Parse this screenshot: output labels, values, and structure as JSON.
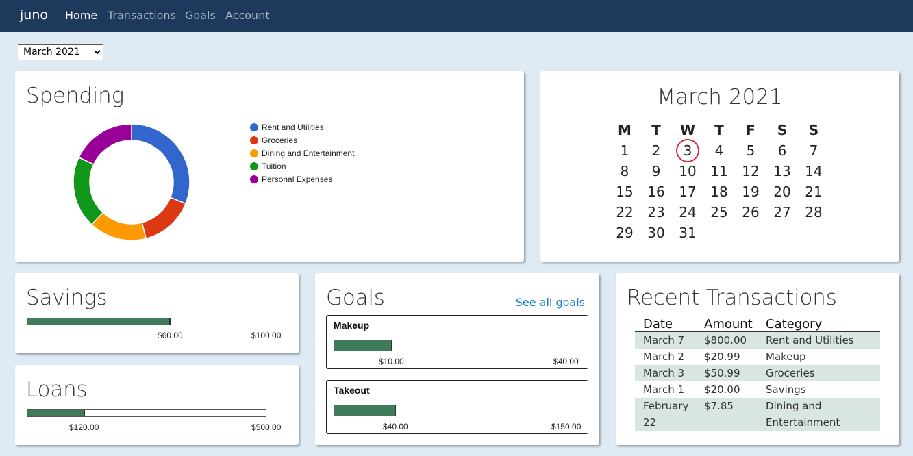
{
  "nav": {
    "brand": "juno",
    "links": [
      "Home",
      "Transactions",
      "Goals",
      "Account"
    ],
    "active": "Home"
  },
  "month_select": {
    "value": "March 2021"
  },
  "spending": {
    "title": "Spending",
    "legend": [
      {
        "label": "Rent and Utilities",
        "color": "#3366cc"
      },
      {
        "label": "Groceries",
        "color": "#dc3912"
      },
      {
        "label": "Dining and Entertainment",
        "color": "#ff9900"
      },
      {
        "label": "Tuition",
        "color": "#109618"
      },
      {
        "label": "Personal Expenses",
        "color": "#990099"
      }
    ]
  },
  "chart_data": {
    "type": "pie",
    "donut": true,
    "categories": [
      "Rent and Utilities",
      "Groceries",
      "Dining and Entertainment",
      "Tuition",
      "Personal Expenses"
    ],
    "values": [
      31,
      15,
      16,
      20,
      18
    ],
    "colors": [
      "#3366cc",
      "#dc3912",
      "#ff9900",
      "#109618",
      "#990099"
    ],
    "legend_position": "right"
  },
  "calendar": {
    "title": "March 2021",
    "weekdays": [
      "M",
      "T",
      "W",
      "T",
      "F",
      "S",
      "S"
    ],
    "first_weekday": 1,
    "days": 31,
    "today": 3
  },
  "savings": {
    "title": "Savings",
    "current_label": "$60.00",
    "target_label": "$100.00",
    "progress": 0.6
  },
  "loans": {
    "title": "Loans",
    "current_label": "$120.00",
    "target_label": "$500.00",
    "progress": 0.24
  },
  "goals": {
    "title": "Goals",
    "see_all": "See all goals",
    "items": [
      {
        "name": "Makeup",
        "current_label": "$10.00",
        "target_label": "$40.00",
        "progress": 0.25
      },
      {
        "name": "Takeout",
        "current_label": "$40.00",
        "target_label": "$150.00",
        "progress": 0.267
      }
    ]
  },
  "transactions": {
    "title": "Recent Transactions",
    "columns": [
      "Date",
      "Amount",
      "Category"
    ],
    "rows": [
      {
        "date": "March 7",
        "amount": "$800.00",
        "category": "Rent and Utilities"
      },
      {
        "date": "March 2",
        "amount": "$20.99",
        "category": "Makeup"
      },
      {
        "date": "March 3",
        "amount": "$50.99",
        "category": "Groceries"
      },
      {
        "date": "March 1",
        "amount": "$20.00",
        "category": "Savings"
      },
      {
        "date": "February 22",
        "amount": "$7.85",
        "category": "Dining and Entertainment"
      }
    ]
  }
}
